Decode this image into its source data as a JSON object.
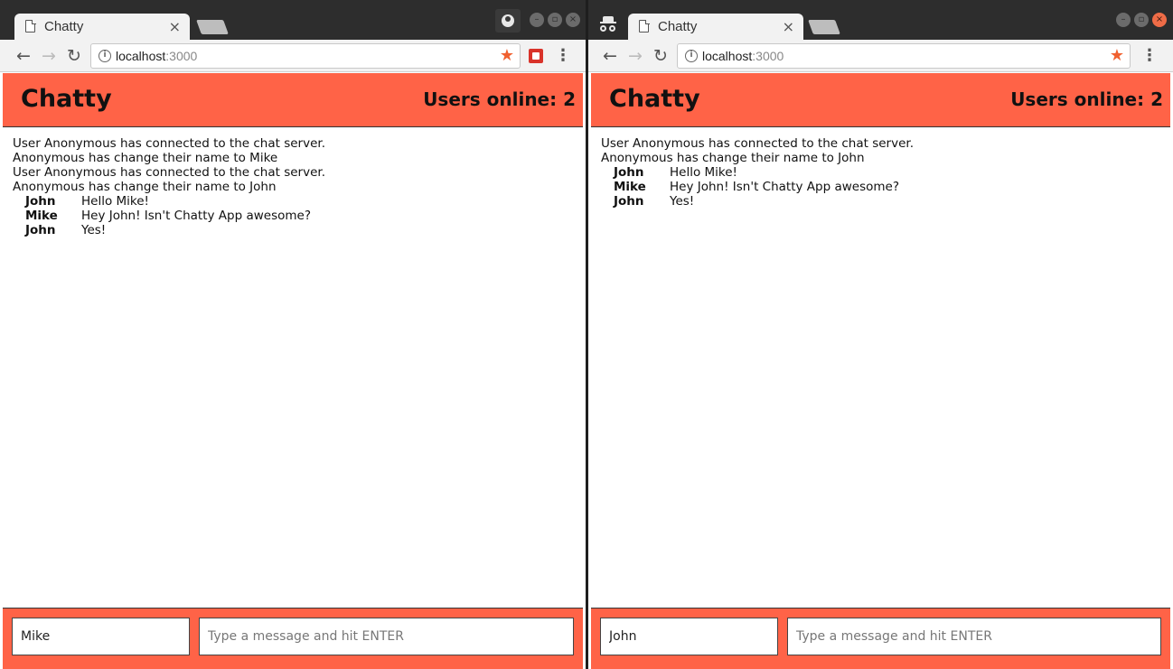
{
  "browser": {
    "tab_title": "Chatty",
    "tab_close": "×",
    "url_host": "localhost",
    "url_port": ":3000",
    "nav_back": "←",
    "nav_forward": "→",
    "nav_reload": "↻",
    "star": "★",
    "menu": "⋮",
    "accent_color": "#f0602f"
  },
  "app": {
    "brand": "Chatty",
    "users_online": "Users online: 2",
    "message_placeholder": "Type a message and hit ENTER",
    "primary_color": "#ff6347"
  },
  "windows": [
    {
      "username_value": "Mike",
      "system_messages": [
        "User Anonymous has connected to the chat server.",
        "Anonymous has change their name to Mike",
        "User Anonymous has connected to the chat server.",
        "Anonymous has change their name to John"
      ],
      "chat_messages": [
        {
          "user": "John",
          "content": "Hello Mike!"
        },
        {
          "user": "Mike",
          "content": "Hey John! Isn't Chatty App awesome?"
        },
        {
          "user": "John",
          "content": "Yes!"
        }
      ]
    },
    {
      "username_value": "John",
      "system_messages": [
        "User Anonymous has connected to the chat server.",
        "Anonymous has change their name to John"
      ],
      "chat_messages": [
        {
          "user": "John",
          "content": "Hello Mike!"
        },
        {
          "user": "Mike",
          "content": "Hey John! Isn't Chatty App awesome?"
        },
        {
          "user": "John",
          "content": "Yes!"
        }
      ]
    }
  ]
}
